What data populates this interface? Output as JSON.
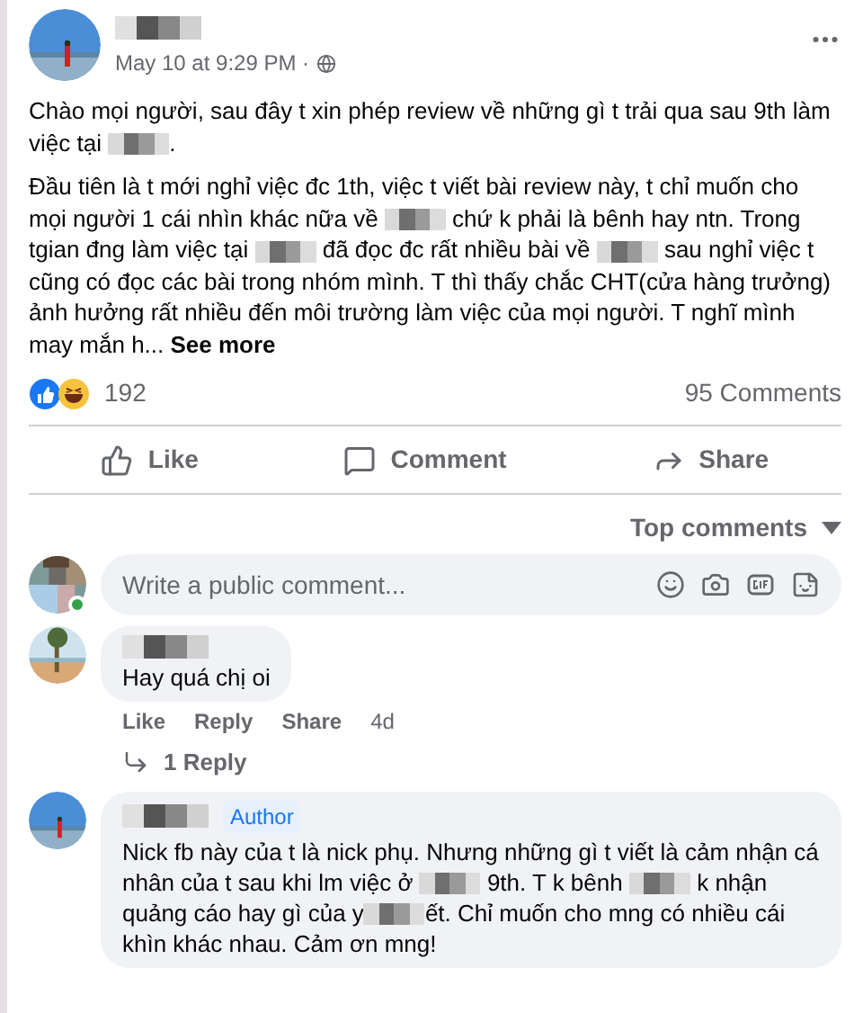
{
  "post": {
    "timestamp": "May 10 at 9:29 PM ·",
    "paragraphs": [
      [
        {
          "kind": "text",
          "text": "Chào mọi người, sau đây t xin phép review về những gì t trải qua sau 9th làm việc tại "
        },
        {
          "kind": "redacted"
        },
        {
          "kind": "text",
          "text": "."
        }
      ],
      [
        {
          "kind": "text",
          "text": "Đầu tiên là t mới nghỉ việc đc 1th, việc t viết bài review này, t chỉ muốn cho mọi người 1 cái nhìn khác nữa về "
        },
        {
          "kind": "redacted"
        },
        {
          "kind": "text",
          "text": " chứ k phải là bênh hay ntn. Trong tgian đng làm việc tại "
        },
        {
          "kind": "redacted"
        },
        {
          "kind": "text",
          "text": " đã đọc đc rất nhiều bài về "
        },
        {
          "kind": "redacted"
        },
        {
          "kind": "text",
          "text": " sau nghỉ việc t cũng có đọc các bài trong nhóm mình. T thì thấy chắc CHT(cửa hàng trưởng) ảnh hưởng rất nhiều đến môi trường làm việc của mọi người. T nghĩ mình may mắn h... "
        },
        {
          "kind": "link",
          "text": "See more"
        }
      ]
    ],
    "reaction_count": "192",
    "comment_count": "95 Comments",
    "actions": [
      "Like",
      "Comment",
      "Share"
    ]
  },
  "comments_header": {
    "sort": "Top comments"
  },
  "composer": {
    "placeholder": "Write a public comment...",
    "online": true
  },
  "comments": [
    {
      "parts": [
        {
          "kind": "text",
          "text": "Hay quá chị oi"
        }
      ],
      "actions": [
        "Like",
        "Reply",
        "Share"
      ],
      "age": "4d",
      "replies_link": "1 Reply"
    },
    {
      "author_badge": "Author",
      "parts": [
        {
          "kind": "text",
          "text": "Nick fb này của t là nick phụ. Nhưng những gì t viết là cảm nhận cá nhân của t sau khi lm việc ở "
        },
        {
          "kind": "redacted"
        },
        {
          "kind": "text",
          "text": " 9th. T k bênh "
        },
        {
          "kind": "redacted"
        },
        {
          "kind": "text",
          "text": " k nhận quảng cáo hay gì của y"
        },
        {
          "kind": "redacted"
        },
        {
          "kind": "text",
          "text": "ết. Chỉ muốn cho mng có nhiều cái khìn khác nhau. Cảm ơn mng!"
        }
      ]
    }
  ]
}
